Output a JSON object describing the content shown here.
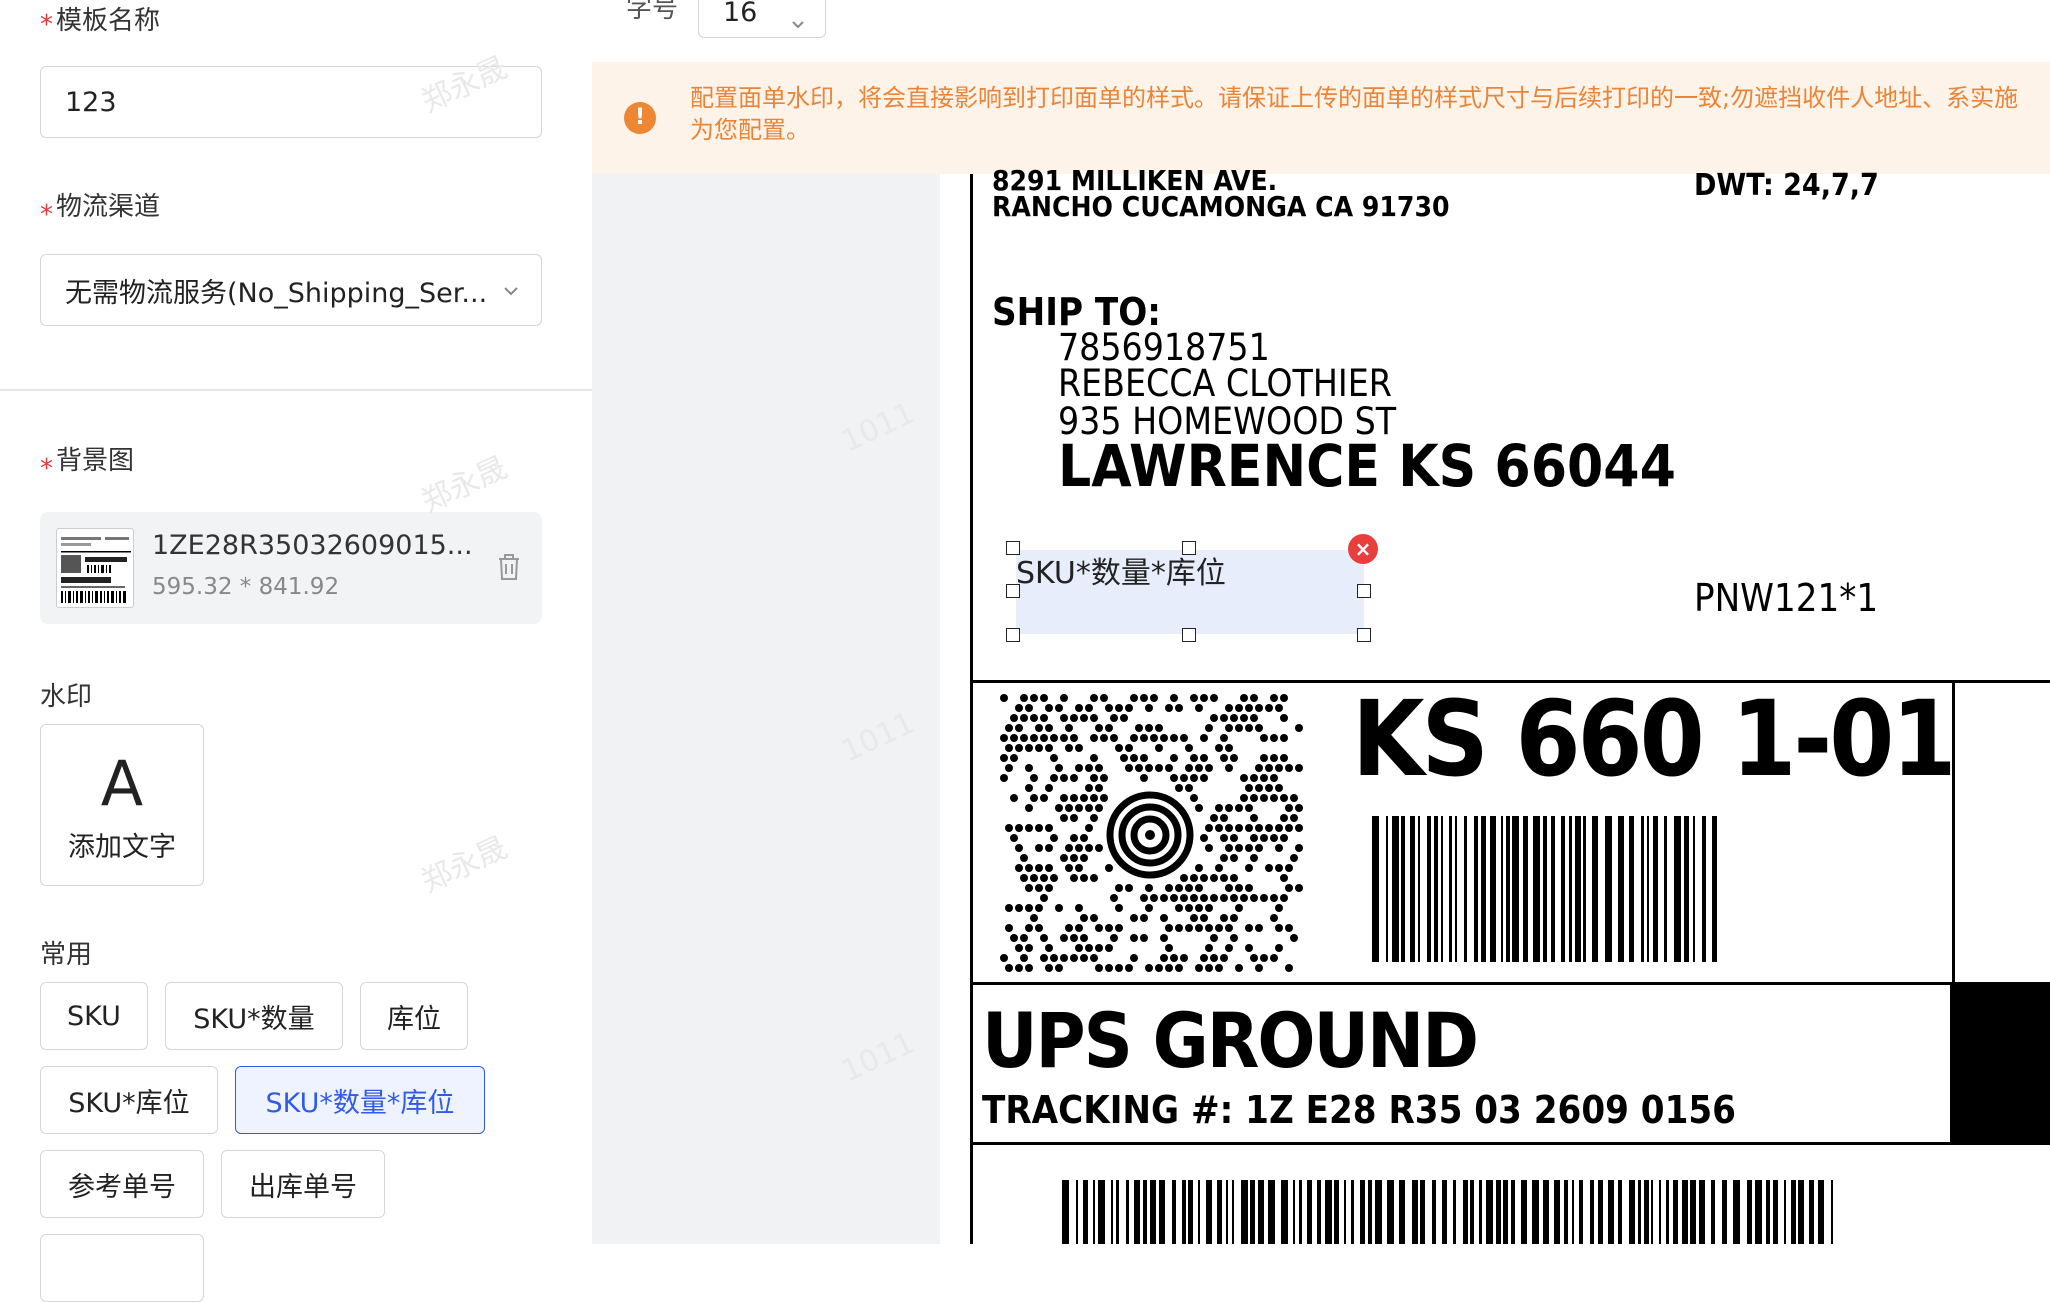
{
  "form": {
    "template_name_label": "模板名称",
    "template_name_value": "123",
    "logistics_label": "物流渠道",
    "logistics_value": "无需物流服务(No_Shipping_Ser...",
    "required_mark": "*"
  },
  "background": {
    "label": "背景图",
    "file_name": "1ZE28R35032609015...",
    "dimensions": "595.32 * 841.92"
  },
  "watermark": {
    "label": "水印",
    "add_text_icon_glyph": "A",
    "add_text_label": "添加文字"
  },
  "common": {
    "label": "常用",
    "tags": [
      "SKU",
      "SKU*数量",
      "库位",
      "SKU*库位",
      "SKU*数量*库位",
      "参考单号",
      "出库单号"
    ],
    "active_tag": "SKU*数量*库位"
  },
  "toolbar": {
    "font_size_label": "字号",
    "font_size_value": "16"
  },
  "notice": {
    "text": "配置面单水印，将会直接影响到打印面单的样式。请保证上传的面单的样式尺寸与后续打印的一致;勿遮挡收件人地址、系实施为您配置。",
    "icon": "warning-icon"
  },
  "label_preview": {
    "street": "8291 MILLIKEN AVE.",
    "city_line": "RANCHO CUCAMONGA  CA 91730",
    "dwt": "DWT: 24,7,7",
    "ship_to_heading": "SHIP TO:",
    "phone": "7856918751",
    "recipient": "REBECCA CLOTHIER",
    "address": "935 HOMEWOOD ST",
    "city_state": "LAWRENCE  KS  66044",
    "pnw": "PNW121*1",
    "routing": "KS 660 1-01",
    "service": "UPS GROUND",
    "tracking": "TRACKING #: 1Z E28 R35 03 2609 0156",
    "selected_field_text": "SKU*数量*库位"
  },
  "colors": {
    "primary": "#2f5bea",
    "warning": "#ee8733",
    "danger": "#e83e3e"
  }
}
